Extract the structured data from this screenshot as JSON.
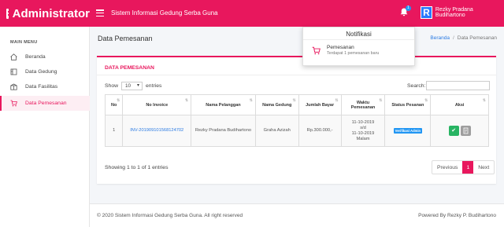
{
  "brand": {
    "name": "Administrator"
  },
  "header": {
    "site_title": "Sistem Informasi Gedung Serba Guna",
    "notification_count": "1",
    "user_initial": "R",
    "user_name": "Rezky Pradana Budihartono"
  },
  "sidebar": {
    "title": "MAIN MENU",
    "items": [
      {
        "label": "Beranda",
        "icon": "home-icon"
      },
      {
        "label": "Data Gedung",
        "icon": "building-icon"
      },
      {
        "label": "Data Fasilitas",
        "icon": "gift-icon"
      },
      {
        "label": "Data Pemesanan",
        "icon": "cart-icon",
        "active": true
      }
    ]
  },
  "page": {
    "title": "Data Pemesanan",
    "breadcrumb": [
      "Beranda",
      "Data Pemesanan"
    ]
  },
  "card": {
    "title": "DATA PEMESANAN",
    "show_label": "Show",
    "entries_value": "10",
    "entries_label": "entries",
    "search_label": "Search:",
    "columns": [
      "No",
      "No Invoice",
      "Nama Pelanggan",
      "Nama Gedung",
      "Jumlah Bayar",
      "Waktu Pemesanan",
      "Status Pesanan",
      "Aksi"
    ],
    "rows": [
      {
        "no": "1",
        "invoice": "INV-20190910156812470​2",
        "customer": "Rezky Pradana Budihartono",
        "building": "Graha Azizah",
        "amount": "Rp.300.000,-",
        "time_from": "11-10-2019",
        "time_sep": "s/d",
        "time_to": "11-10-2019",
        "time_slot": "Malam",
        "status": "Verifikasi Admin"
      }
    ],
    "showing": "Showing 1 to 1 of 1 entries",
    "pager": {
      "prev": "Previous",
      "current": "1",
      "next": "Next"
    }
  },
  "footer": {
    "copyright": "© 2020 Sistem Informasi Gedung Serba Guna. All right reserved",
    "powered": "Powered By Rezky P. Budihartono"
  },
  "notification": {
    "title": "Notifikasi",
    "item_title": "Pemesanan",
    "item_desc_prefix": "Terdapat ",
    "item_count": "1",
    "item_desc_suffix": " pemesanan baru"
  },
  "colors": {
    "primary": "#e8175d",
    "link": "#2a7ae2",
    "badge": "#2196f3",
    "success": "#28b463"
  }
}
